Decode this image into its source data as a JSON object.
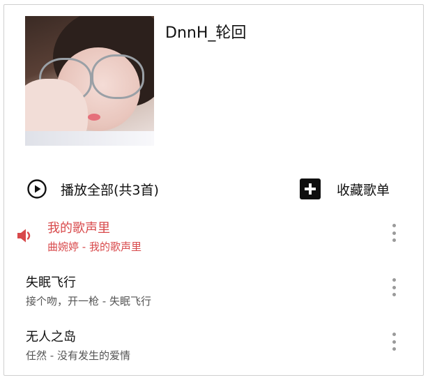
{
  "playlist": {
    "title": "DnnH_轮回",
    "cover_icon": "album-cover-image"
  },
  "actions": {
    "play_all_label": "播放全部(共3首)",
    "play_icon": "play-circle-icon",
    "collect_label": "收藏歌单",
    "collect_icon": "plus-square-icon"
  },
  "songs": [
    {
      "title": "我的歌声里",
      "subtitle": "曲婉婷 - 我的歌声里",
      "playing": true
    },
    {
      "title": "失眠飞行",
      "subtitle": "接个吻，开一枪 - 失眠飞行",
      "playing": false
    },
    {
      "title": "无人之岛",
      "subtitle": "任然 - 没有发生的爱情",
      "playing": false
    }
  ],
  "colors": {
    "accent": "#d8494b",
    "text": "#111111",
    "subtext": "#555555",
    "more_dots": "#9a9a9a"
  }
}
